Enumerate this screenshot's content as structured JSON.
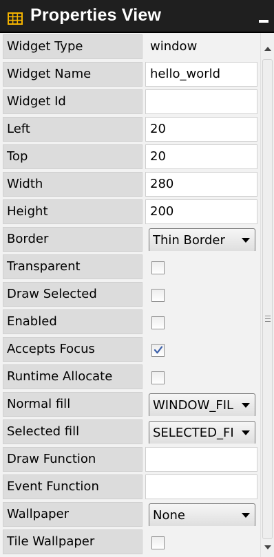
{
  "panel": {
    "title": "Properties View",
    "icon": "table-grid-icon",
    "accent_color": "#f5b400",
    "minimize_icon": "minimize-icon"
  },
  "properties": [
    {
      "name": "Widget Type",
      "kind": "static",
      "value": "window"
    },
    {
      "name": "Widget Name",
      "kind": "text",
      "value": "hello_world"
    },
    {
      "name": "Widget Id",
      "kind": "text",
      "value": ""
    },
    {
      "name": "Left",
      "kind": "text",
      "value": "20"
    },
    {
      "name": "Top",
      "kind": "text",
      "value": "20"
    },
    {
      "name": "Width",
      "kind": "text",
      "value": "280"
    },
    {
      "name": "Height",
      "kind": "text",
      "value": "200"
    },
    {
      "name": "Border",
      "kind": "select",
      "value": "Thin Border"
    },
    {
      "name": "Transparent",
      "kind": "checkbox",
      "checked": false
    },
    {
      "name": "Draw Selected",
      "kind": "checkbox",
      "checked": false
    },
    {
      "name": "Enabled",
      "kind": "checkbox",
      "checked": false
    },
    {
      "name": "Accepts Focus",
      "kind": "checkbox",
      "checked": true
    },
    {
      "name": "Runtime Allocate",
      "kind": "checkbox",
      "checked": false
    },
    {
      "name": "Normal fill",
      "kind": "select",
      "value": "WINDOW_FILL"
    },
    {
      "name": "Selected fill",
      "kind": "select",
      "value": "SELECTED_FILL"
    },
    {
      "name": "Draw Function",
      "kind": "text",
      "value": ""
    },
    {
      "name": "Event Function",
      "kind": "text",
      "value": ""
    },
    {
      "name": "Wallpaper",
      "kind": "select",
      "value": "None"
    },
    {
      "name": "Tile Wallpaper",
      "kind": "checkbox",
      "checked": false
    }
  ]
}
